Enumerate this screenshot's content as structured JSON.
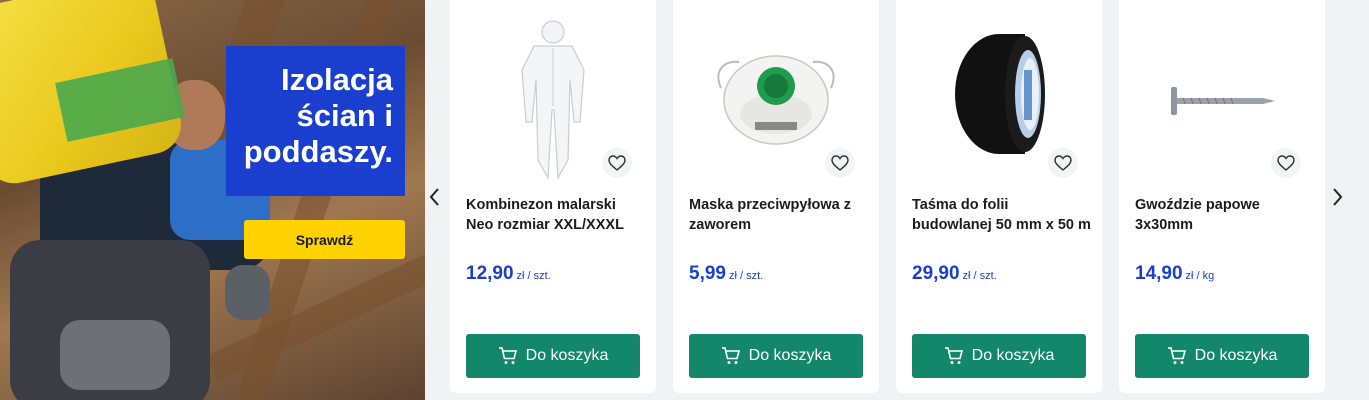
{
  "banner": {
    "headline_lines": [
      "Izolacja",
      "ścian i",
      "poddaszy."
    ],
    "cta_label": "Sprawdź",
    "colors": {
      "headline_bg": "#1a3fcf",
      "cta_bg": "#ffd200"
    }
  },
  "carousel": {
    "prev_icon": "chevron-left-icon",
    "next_icon": "chevron-right-icon",
    "products": [
      {
        "name": "Kombinezon malarski Neo rozmiar XXL/XXXL",
        "price": "12,90",
        "unit": "zł / szt.",
        "cart_label": "Do koszyka",
        "image": "coverall-suit"
      },
      {
        "name": "Maska przeciwpyłowa z zaworem",
        "price": "5,99",
        "unit": "zł / szt.",
        "cart_label": "Do koszyka",
        "image": "dust-mask"
      },
      {
        "name": "Taśma do folii budowlanej 50 mm x 50 m",
        "price": "29,90",
        "unit": "zł / szt.",
        "cart_label": "Do koszyka",
        "image": "tape-roll"
      },
      {
        "name": "Gwoździe papowe 3x30mm",
        "price": "14,90",
        "unit": "zł / kg",
        "cart_label": "Do koszyka",
        "image": "roofing-nail"
      }
    ]
  },
  "colors": {
    "price": "#1a3fcf",
    "cart_button": "#12876a"
  }
}
